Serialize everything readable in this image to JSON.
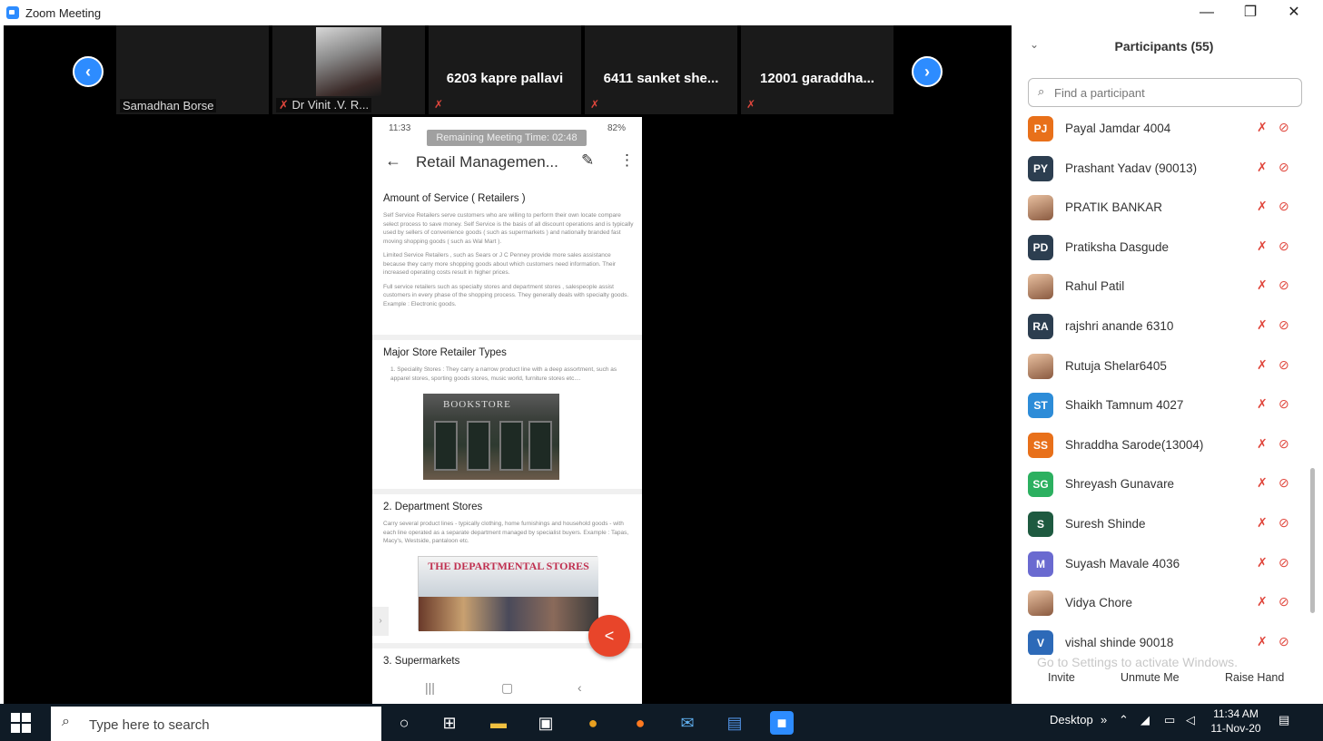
{
  "window": {
    "title": "Zoom Meeting",
    "minimize": "—",
    "restore": "❐",
    "close": "✕"
  },
  "thumbnails": [
    {
      "name": "",
      "label": "Samadhan Borse",
      "muted": false
    },
    {
      "name": "",
      "label": "Dr Vinit .V. R...",
      "muted": true,
      "has_video": true
    },
    {
      "name": "6203 kapre pallavi",
      "label": "",
      "muted": true
    },
    {
      "name": "6411 sanket she...",
      "label": "",
      "muted": true
    },
    {
      "name": "12001 garaddha...",
      "label": "",
      "muted": true
    }
  ],
  "nav": {
    "prev": "‹",
    "next": "›"
  },
  "phone": {
    "status_time": "11:33",
    "status_battery": "82%",
    "meeting_timer": "Remaining Meeting Time: 02:48",
    "doc_title": "Retail Managemen...",
    "sections": [
      {
        "heading": "Amount of Service ( Retailers )",
        "paragraphs": [
          "Self Service Retailers serve customers who are willing to perform their own locate compare select process to save money. Self Service is the basis of all discount operations and is typically used by sellers of convenience goods ( such as supermarkets ) and nationally branded fast moving shopping goods ( such as Wal Mart ).",
          "Limited Service Retailers , such as Sears or J C Penney provide more sales assistance because they carry more shopping goods about which customers need information. Their increased operating costs result in higher prices.",
          "Full service retailers such as specialty stores and department stores , salespeople assist customers in every phase of the shopping process. They generally deals with specialty goods. Example : Electronic goods."
        ]
      },
      {
        "heading": "Major Store Retailer Types",
        "paragraphs": [
          "1. Speciality Stores : They carry a narrow product line with a deep assortment, such as apparel stores, sporting goods stores, music world, furniture stores etc...."
        ],
        "image_sign": "BOOKSTORE"
      },
      {
        "heading": "2. Department Stores",
        "paragraphs": [
          "Carry several product lines - typically clothing, home furnishings and household goods - with each line operated as a separate department managed by specialist buyers. Example : Tapas, Macy's, Westside, pantaloon etc."
        ],
        "image_label": "THE DEPARTMENTAL STORES"
      },
      {
        "heading": "3. Supermarkets",
        "paragraphs": []
      }
    ],
    "nav_recent": "|||",
    "nav_home": "▢",
    "nav_back": "‹"
  },
  "participants": {
    "title": "Participants (55)",
    "search_placeholder": "Find a participant",
    "list": [
      {
        "initials": "PJ",
        "name": "Payal Jamdar 4004",
        "color": "#e8701a"
      },
      {
        "initials": "PY",
        "name": "Prashant Yadav (90013)",
        "color": "#2c3e50"
      },
      {
        "initials": "",
        "name": "PRATIK BANKAR",
        "color": "#8aa0b8",
        "photo": true
      },
      {
        "initials": "PD",
        "name": "Pratiksha Dasgude",
        "color": "#2c3e50"
      },
      {
        "initials": "",
        "name": "Rahul Patil",
        "color": "#c87858",
        "photo": true
      },
      {
        "initials": "RA",
        "name": "rajshri anande 6310",
        "color": "#2c3e50"
      },
      {
        "initials": "",
        "name": "Rutuja Shelar6405",
        "color": "#c83838",
        "photo": true
      },
      {
        "initials": "ST",
        "name": "Shaikh Tamnum 4027",
        "color": "#2d8cd8"
      },
      {
        "initials": "SS",
        "name": "Shraddha Sarode(13004)",
        "color": "#e8701a"
      },
      {
        "initials": "SG",
        "name": "Shreyash Gunavare",
        "color": "#2cb060"
      },
      {
        "initials": "S",
        "name": "Suresh Shinde",
        "color": "#1e5a40"
      },
      {
        "initials": "M",
        "name": "Suyash Mavale 4036",
        "color": "#6a6ad0"
      },
      {
        "initials": "",
        "name": "Vidya Chore",
        "color": "#c89870",
        "photo": true
      },
      {
        "initials": "V",
        "name": "vishal shinde 90018",
        "color": "#2d6ab8"
      }
    ],
    "watermark": "Go to Settings to activate Windows.",
    "invite": "Invite",
    "unmute": "Unmute Me",
    "raise_hand": "Raise Hand"
  },
  "taskbar": {
    "search_text": "Type here to search",
    "desktop": "Desktop",
    "time": "11:34 AM",
    "date": "11-Nov-20"
  }
}
